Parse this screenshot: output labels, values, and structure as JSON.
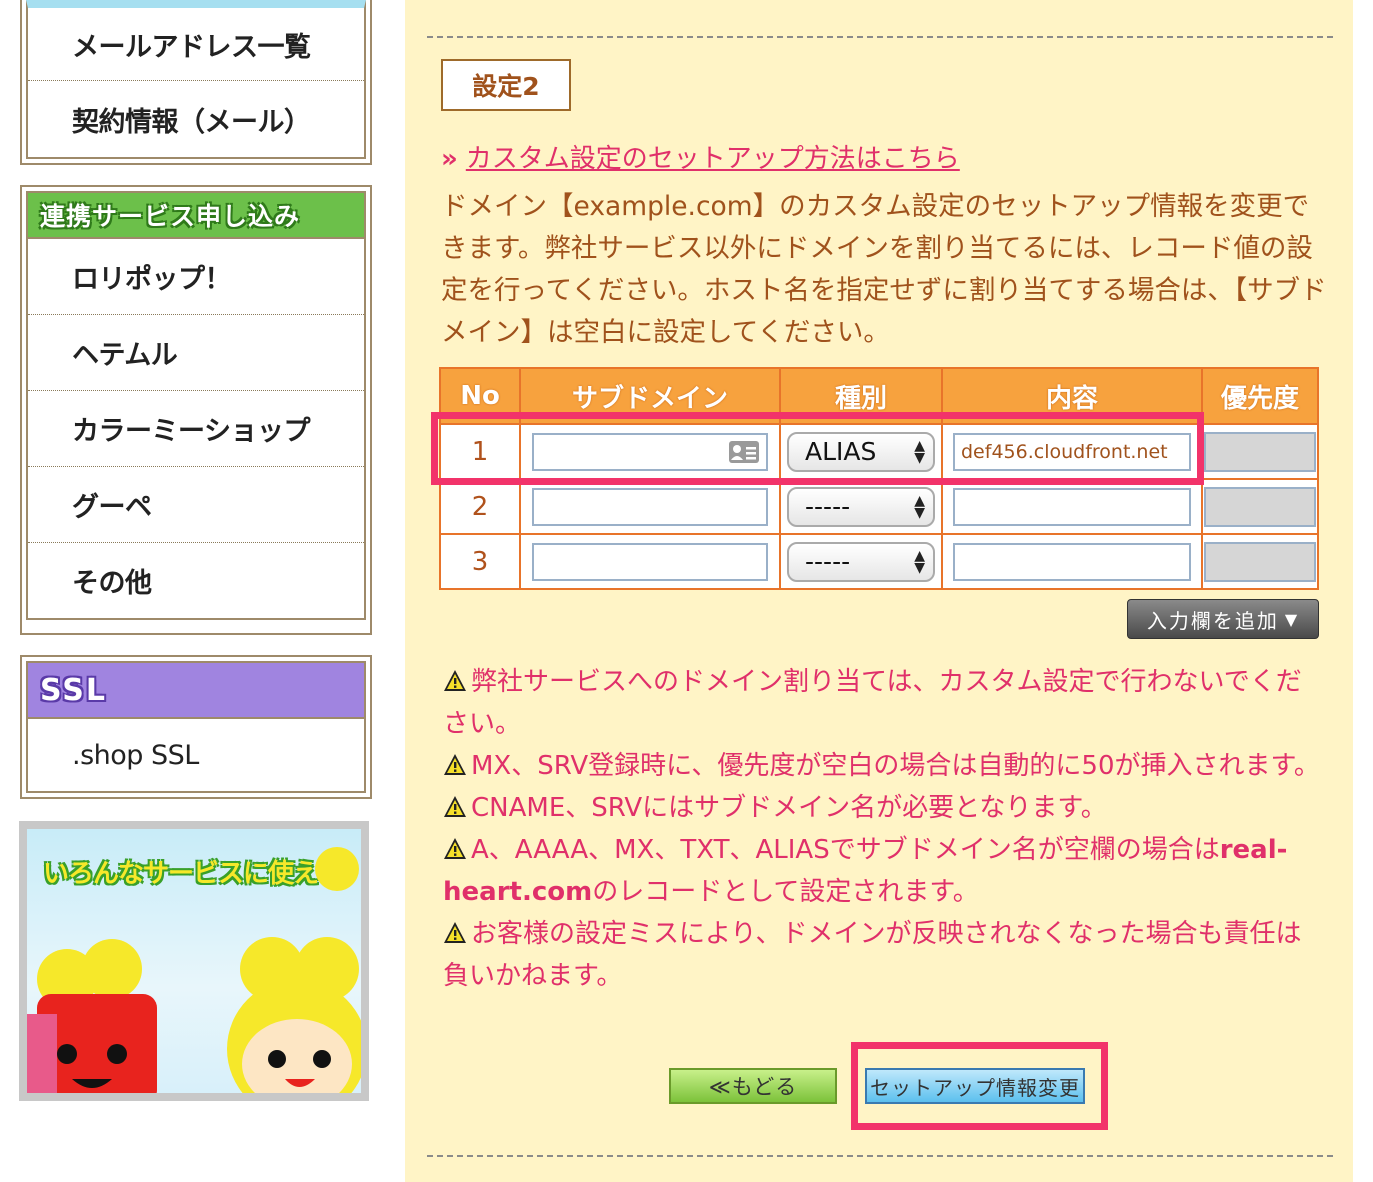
{
  "sidebar": {
    "mail_box": {
      "items": [
        {
          "label": "メールアドレス一覧"
        },
        {
          "label": "契約情報（メール）"
        }
      ]
    },
    "service_box": {
      "header": "連携サービス申し込み",
      "items": [
        {
          "label": "ロリポップ！"
        },
        {
          "label": "ヘテムル"
        },
        {
          "label": "カラーミーショップ"
        },
        {
          "label": "グーペ"
        },
        {
          "label": "その他"
        }
      ]
    },
    "ssl_box": {
      "header": "SSL",
      "items": [
        {
          "label": ".shop SSL"
        }
      ]
    },
    "banner": {
      "text": "いろんなサービスに使えて"
    }
  },
  "main": {
    "section_title": "設定2",
    "setup_link": "カスタム設定のセットアップ方法はこちら",
    "description": "ドメイン【example.com】のカスタム設定のセットアップ情報を変更できます。弊社サービス以外にドメインを割り当てるには、レコード値の設定を行ってください。ホスト名を指定せずに割り当てする場合は、【サブドメイン】は空白に設定してください。",
    "table": {
      "headers": [
        "No",
        "サブドメイン",
        "種別",
        "内容",
        "優先度"
      ],
      "rows": [
        {
          "no": "1",
          "subdomain": "",
          "type": "ALIAS",
          "content": "def456.cloudfront.net",
          "priority": ""
        },
        {
          "no": "2",
          "subdomain": "",
          "type": "-----",
          "content": "",
          "priority": ""
        },
        {
          "no": "3",
          "subdomain": "",
          "type": "-----",
          "content": "",
          "priority": ""
        }
      ]
    },
    "add_button": "入力欄を追加",
    "warnings": [
      {
        "text": "弊社サービスへのドメイン割り当ては、カスタム設定で行わないでください。"
      },
      {
        "text": "MX、SRV登録時に、優先度が空白の場合は自動的に50が挿入されます。"
      },
      {
        "text": "CNAME、SRVにはサブドメイン名が必要となります。"
      },
      {
        "text_pre": "A、AAAA、MX、TXT、ALIASでサブドメイン名が空欄の場合は",
        "text_bold": "real-heart.com",
        "text_post": "のレコードとして設定されます。"
      },
      {
        "text": "お客様の設定ミスにより、ドメインが反映されなくなった場合も責任は負いかねます。"
      }
    ],
    "back_button": "≪もどる",
    "submit_button": "セットアップ情報変更"
  },
  "colors": {
    "highlight": "#f2336a",
    "panel_bg": "#fff4c6",
    "table_header": "#f7a23e",
    "warning_text": "#e0306a",
    "body_text": "#a0521c"
  }
}
